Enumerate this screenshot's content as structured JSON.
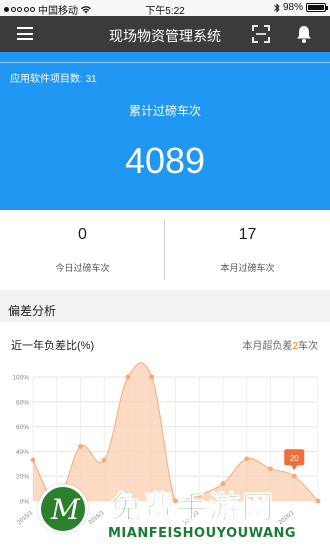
{
  "status_bar": {
    "carrier": "中国移动",
    "time": "下午5:22",
    "battery": "98%",
    "battery_level": 0.98
  },
  "nav": {
    "title": "现场物资管理系统",
    "icons": [
      "menu-icon",
      "scan-icon",
      "bell-icon"
    ]
  },
  "summary": {
    "project_label": "应用软件项目数:",
    "project_count": "31",
    "total_label": "累计过磅车次",
    "total_value": "4089"
  },
  "stats": [
    {
      "value": "0",
      "label": "今日过磅车次"
    },
    {
      "value": "17",
      "label": "本月过磅车次"
    }
  ],
  "section": {
    "title": "偏差分析",
    "chart_title": "近一年负差比(%)",
    "month_prefix": "本月超负差",
    "month_count": "2",
    "month_suffix": "车次"
  },
  "colors": {
    "accent": "#1f97f3",
    "nav_bg": "#3a3b3d",
    "area_fill": "#f9cfb0",
    "highlight": "#f08300",
    "tooltip": "#f26c3a"
  },
  "chart_data": {
    "type": "area",
    "ylabel": "",
    "xlabel": "",
    "y_ticks": [
      "100%",
      "80%",
      "60%",
      "40%",
      "20%",
      "0%"
    ],
    "ylim": [
      0,
      100
    ],
    "x_tick_labels": [
      "2015/1",
      "",
      "",
      "2016/1",
      "",
      "",
      "",
      "2016/1",
      "",
      "",
      "",
      "2016/1",
      ""
    ],
    "values": [
      33,
      0,
      44,
      33,
      100,
      100,
      0,
      5,
      14,
      34,
      26,
      20,
      0
    ],
    "tooltip_value": "20",
    "grid": true
  },
  "watermark": {
    "cn": "免费手游网",
    "en": "MIANFEISHOUYOUWANG"
  }
}
